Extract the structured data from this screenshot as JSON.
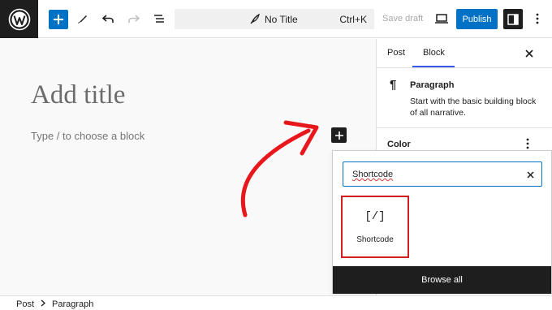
{
  "toolbar": {
    "logo_icon": "wordpress-logo",
    "add_icon": "plus-icon",
    "tools": [
      {
        "icon": "pencil-icon"
      },
      {
        "icon": "undo-icon"
      },
      {
        "icon": "redo-icon"
      },
      {
        "icon": "list-view-icon"
      }
    ],
    "command": {
      "title": "No Title",
      "shortcut": "Ctrl+K"
    },
    "save_draft": "Save draft",
    "preview_icon": "desktop-preview-icon",
    "publish": "Publish",
    "settings_icon": "sidebar-toggle-icon",
    "options_icon": "more-vertical-icon"
  },
  "editor": {
    "title_placeholder": "Add title",
    "block_placeholder": "Type / to choose a block"
  },
  "sidebar": {
    "tabs": [
      "Post",
      "Block"
    ],
    "active_tab": "Block",
    "block": {
      "icon": "¶",
      "name": "Paragraph",
      "description": "Start with the basic building block of all narrative."
    },
    "color_label": "Color"
  },
  "inserter": {
    "search_value": "Shortcode",
    "result": {
      "icon": "[/]",
      "label": "Shortcode"
    },
    "browse_all": "Browse all"
  },
  "footer": {
    "breadcrumb": [
      "Post",
      "Paragraph"
    ]
  },
  "colors": {
    "accent": "#0072c6",
    "dark": "#1e1e1e",
    "highlight": "#d11f1f",
    "annotation_arrow": "#e8171b"
  }
}
